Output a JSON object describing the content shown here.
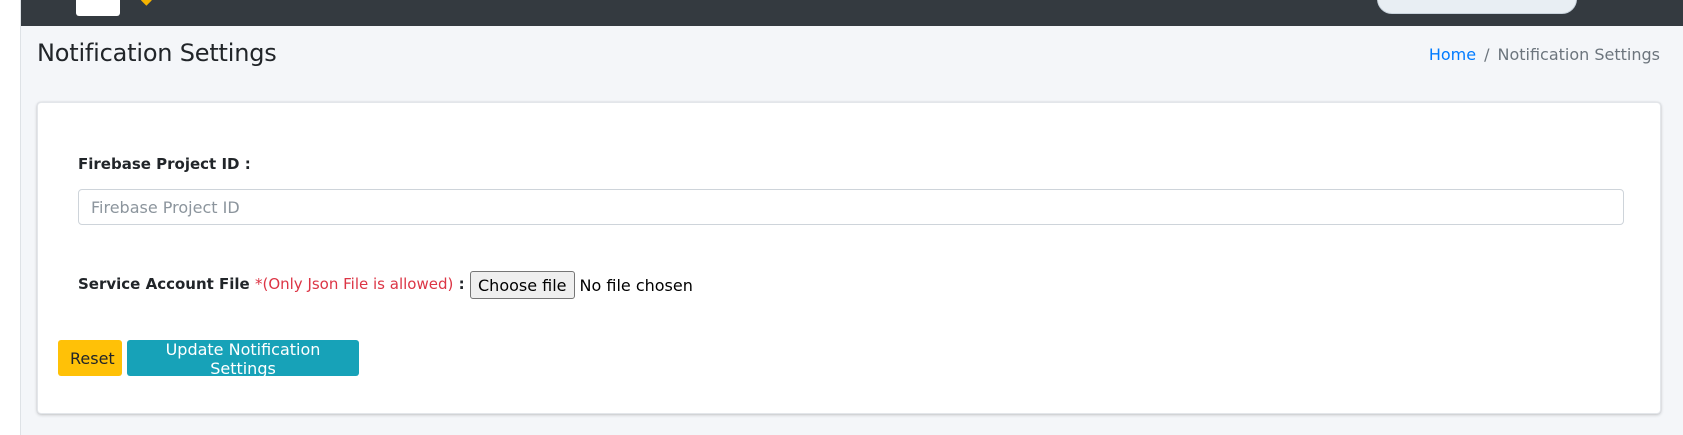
{
  "header": {
    "logo_icon": "brand-logo",
    "user_menu_icon": "user-menu-pill"
  },
  "page": {
    "title": "Notification Settings"
  },
  "breadcrumb": {
    "home": "Home",
    "separator": "/",
    "current": "Notification Settings"
  },
  "form": {
    "project_id": {
      "label": "Firebase Project ID :",
      "value": "",
      "placeholder": "Firebase Project ID"
    },
    "service_file": {
      "label": "Service Account File",
      "required_note": "*(Only Json File is allowed)",
      "colon": ":",
      "button_label": "Choose file",
      "status": "No file chosen"
    },
    "buttons": {
      "reset": "Reset",
      "update": "Update Notification Settings"
    }
  },
  "colors": {
    "topbar": "#343a40",
    "link": "#007bff",
    "required": "#dc3545",
    "reset_button": "#ffc107",
    "update_button": "#17a2b8",
    "content_bg": "#f4f6f9"
  }
}
